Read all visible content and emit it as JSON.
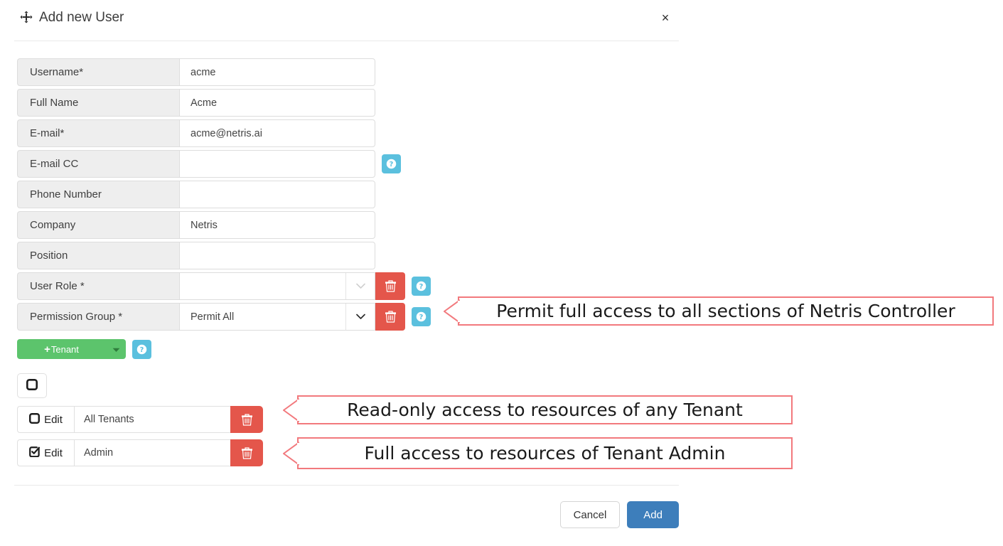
{
  "dialog": {
    "title": "Add new User",
    "move_icon": "move-arrows-icon",
    "close_label": "×"
  },
  "form": {
    "rows": [
      {
        "label": "Username*",
        "value": "acme",
        "type": "text"
      },
      {
        "label": "Full Name",
        "value": "Acme",
        "type": "text"
      },
      {
        "label": "E-mail*",
        "value": "acme@netris.ai",
        "type": "text"
      },
      {
        "label": "E-mail CC",
        "value": "",
        "type": "text",
        "help": true
      },
      {
        "label": "Phone Number",
        "value": "",
        "type": "text"
      },
      {
        "label": "Company",
        "value": "Netris",
        "type": "text"
      },
      {
        "label": "Position",
        "value": "",
        "type": "text"
      },
      {
        "label": "User Role *",
        "value": "",
        "type": "select",
        "trash": true,
        "help": true,
        "caret_muted": true
      },
      {
        "label": "Permission Group *",
        "value": "Permit All",
        "type": "select",
        "trash": true,
        "help": true,
        "caret_muted": false
      }
    ]
  },
  "tenant_control": {
    "add_label": "Tenant",
    "add_plus": "+",
    "caret_icon": "caret-down-icon",
    "help_icon": "question-circle-icon"
  },
  "tenant_toolbar": {
    "stop_icon": "square-outline-icon"
  },
  "tenant_list": {
    "edit_label": "Edit",
    "rows": [
      {
        "icon": "square-outline-icon",
        "name": "All Tenants",
        "trash_icon": "trash-icon"
      },
      {
        "icon": "square-check-icon",
        "name": "Admin",
        "trash_icon": "trash-icon"
      }
    ]
  },
  "callouts": [
    {
      "text": "Permit full access to all sections of Netris Controller"
    },
    {
      "text": "Read-only access to resources of any Tenant"
    },
    {
      "text": "Full access to resources of Tenant Admin"
    }
  ],
  "footer": {
    "cancel_label": "Cancel",
    "add_label": "Add"
  },
  "colors": {
    "accent_blue": "#3d7ebb",
    "help_blue": "#5bc0de",
    "danger_red": "#e4564b",
    "success_green": "#5cc46c",
    "callout_red": "#f2797d",
    "label_gray": "#eeeeee"
  }
}
